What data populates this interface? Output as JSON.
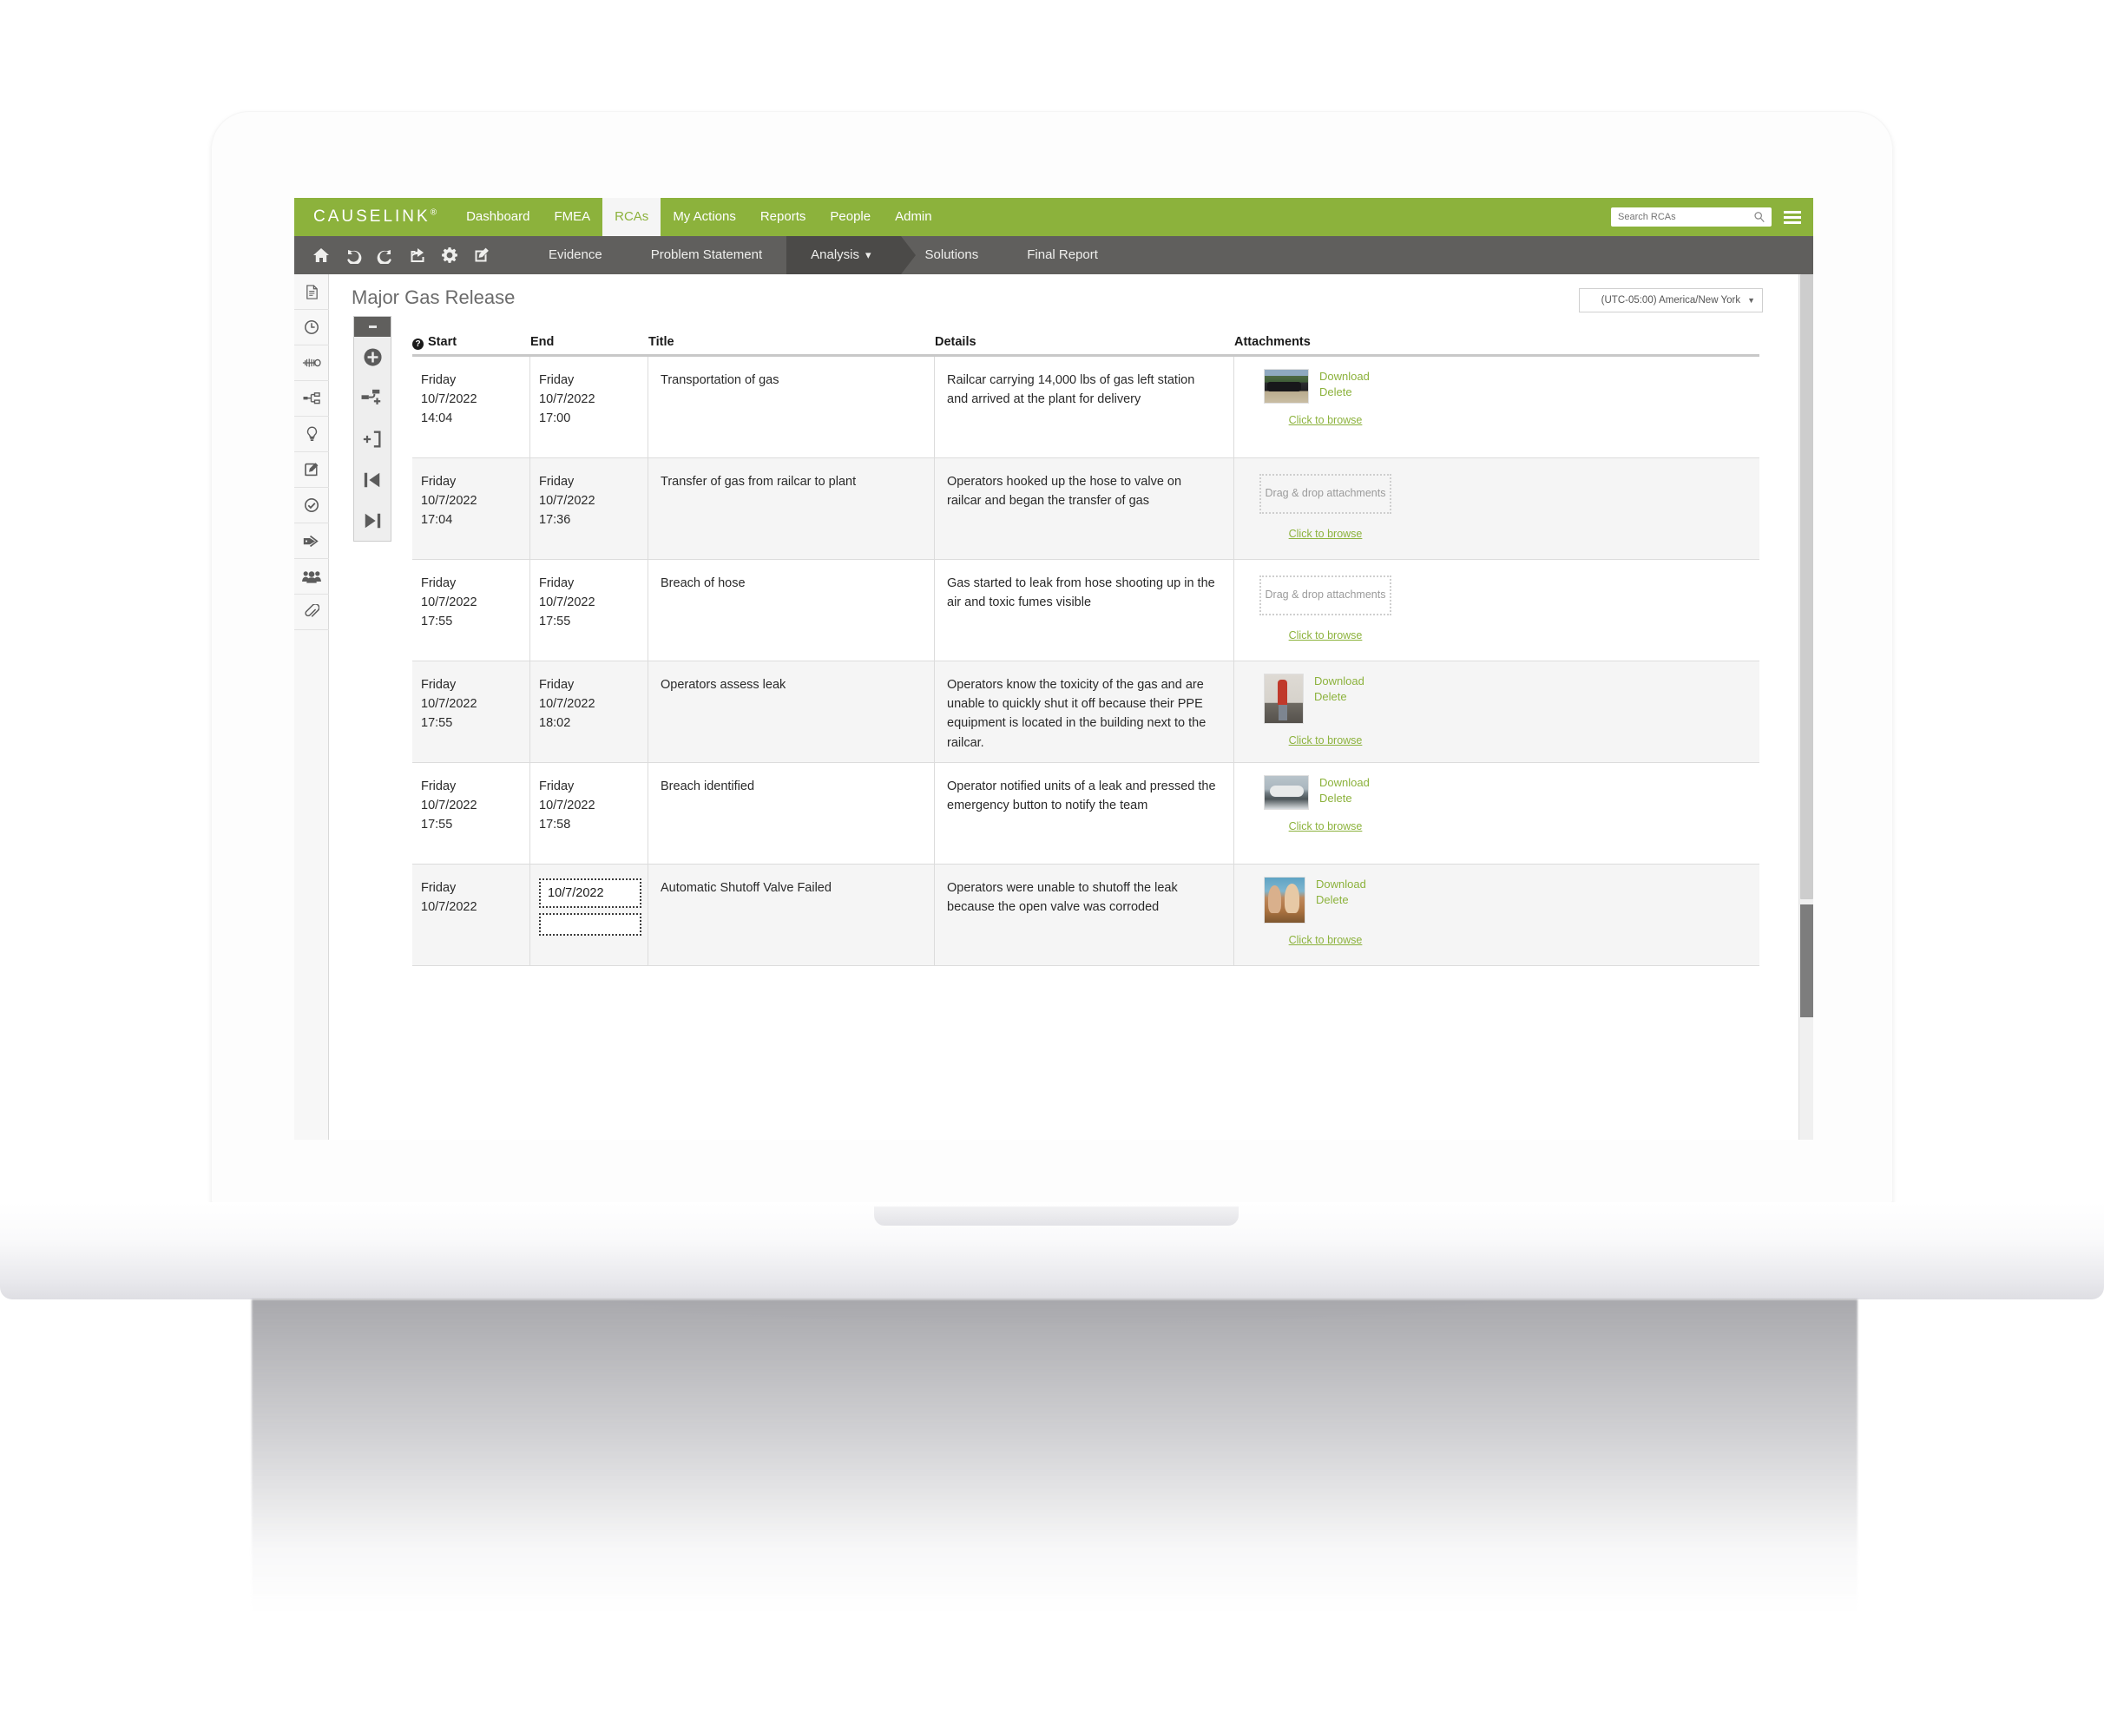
{
  "app": {
    "brand": "CAUSELINK",
    "brand_mark": "®",
    "nav": [
      {
        "label": "Dashboard",
        "active": false
      },
      {
        "label": "FMEA",
        "active": false
      },
      {
        "label": "RCAs",
        "active": true
      },
      {
        "label": "My Actions",
        "active": false
      },
      {
        "label": "Reports",
        "active": false
      },
      {
        "label": "People",
        "active": false
      },
      {
        "label": "Admin",
        "active": false
      }
    ],
    "search": {
      "value": "",
      "placeholder": "Search RCAs"
    },
    "accent_green": "#8cb23c",
    "toolbar_gray": "#605f5d"
  },
  "toolbar": {
    "icons": [
      {
        "name": "home-icon"
      },
      {
        "name": "undo-icon"
      },
      {
        "name": "redo-icon"
      },
      {
        "name": "share-icon"
      },
      {
        "name": "gear-icon"
      },
      {
        "name": "edit-icon"
      }
    ],
    "steps": [
      {
        "label": "Evidence",
        "active": false
      },
      {
        "label": "Problem Statement",
        "active": false
      },
      {
        "label": "Analysis",
        "active": true,
        "caret": "⌄"
      },
      {
        "label": "Solutions",
        "active": false
      },
      {
        "label": "Final Report",
        "active": false
      }
    ]
  },
  "rail": [
    {
      "name": "document-icon"
    },
    {
      "name": "clock-icon"
    },
    {
      "name": "fishbone-icon"
    },
    {
      "name": "tree-diagram-icon"
    },
    {
      "name": "lightbulb-icon"
    },
    {
      "name": "notes-edit-icon"
    },
    {
      "name": "check-circle-icon"
    },
    {
      "name": "tags-icon"
    },
    {
      "name": "people-icon"
    },
    {
      "name": "paperclip-icon"
    }
  ],
  "page": {
    "title": "Major Gas Release",
    "timezone": "(UTC-05:00) America/New York"
  },
  "vtool": {
    "buttons": [
      {
        "name": "add-event-button"
      },
      {
        "name": "add-linked-event-button"
      },
      {
        "name": "insert-before-button"
      },
      {
        "name": "jump-to-first-button"
      },
      {
        "name": "jump-to-last-button"
      }
    ]
  },
  "table": {
    "headers": [
      "Start",
      "End",
      "Title",
      "Details",
      "Attachments"
    ],
    "help_glyph": "?",
    "attachment_labels": {
      "download": "Download",
      "delete": "Delete",
      "browse": "Click to browse",
      "dropzone": "Drag & drop attachments"
    },
    "rows": [
      {
        "start": {
          "day": "Friday",
          "date": "10/7/2022",
          "time": "14:04"
        },
        "end": {
          "day": "Friday",
          "date": "10/7/2022",
          "time": "17:00"
        },
        "title": "Transportation of gas",
        "details": "Railcar carrying 14,000 lbs of gas left station and arrived at the plant for delivery",
        "attachment": {
          "type": "thumb",
          "image": "railcar-photo"
        }
      },
      {
        "start": {
          "day": "Friday",
          "date": "10/7/2022",
          "time": "17:04"
        },
        "end": {
          "day": "Friday",
          "date": "10/7/2022",
          "time": "17:36"
        },
        "title": "Transfer of gas from railcar to plant",
        "details": "Operators hooked up the hose to valve on railcar and began the transfer of gas",
        "attachment": {
          "type": "dropzone"
        }
      },
      {
        "start": {
          "day": "Friday",
          "date": "10/7/2022",
          "time": "17:55"
        },
        "end": {
          "day": "Friday",
          "date": "10/7/2022",
          "time": "17:55"
        },
        "title": "Breach of hose",
        "details": "Gas started to leak from  hose shooting up in the air and toxic fumes visible",
        "attachment": {
          "type": "dropzone"
        }
      },
      {
        "start": {
          "day": "Friday",
          "date": "10/7/2022",
          "time": "17:55"
        },
        "end": {
          "day": "Friday",
          "date": "10/7/2022",
          "time": "18:02"
        },
        "title": "Operators assess leak",
        "details": "Operators know the toxicity of the gas and are unable to quickly shut it off because their PPE equipment is located in the building next to the railcar.",
        "attachment": {
          "type": "thumb",
          "image": "worker-photo"
        }
      },
      {
        "start": {
          "day": "Friday",
          "date": "10/7/2022",
          "time": "17:55"
        },
        "end": {
          "day": "Friday",
          "date": "10/7/2022",
          "time": "17:58"
        },
        "title": "Breach identified",
        "details": "Operator notified units of a leak and pressed the emergency button to notify the team",
        "attachment": {
          "type": "thumb",
          "image": "tank-photo"
        }
      },
      {
        "start": {
          "day": "Friday",
          "date": "10/7/2022",
          "time": ""
        },
        "end": {
          "day": "",
          "date": "10/7/2022",
          "time": "",
          "editing": true
        },
        "title": "Automatic Shutoff Valve Failed",
        "details": "Operators were unable to shutoff the leak because the open valve was corroded",
        "attachment": {
          "type": "thumb",
          "image": "people-photo"
        }
      }
    ]
  }
}
